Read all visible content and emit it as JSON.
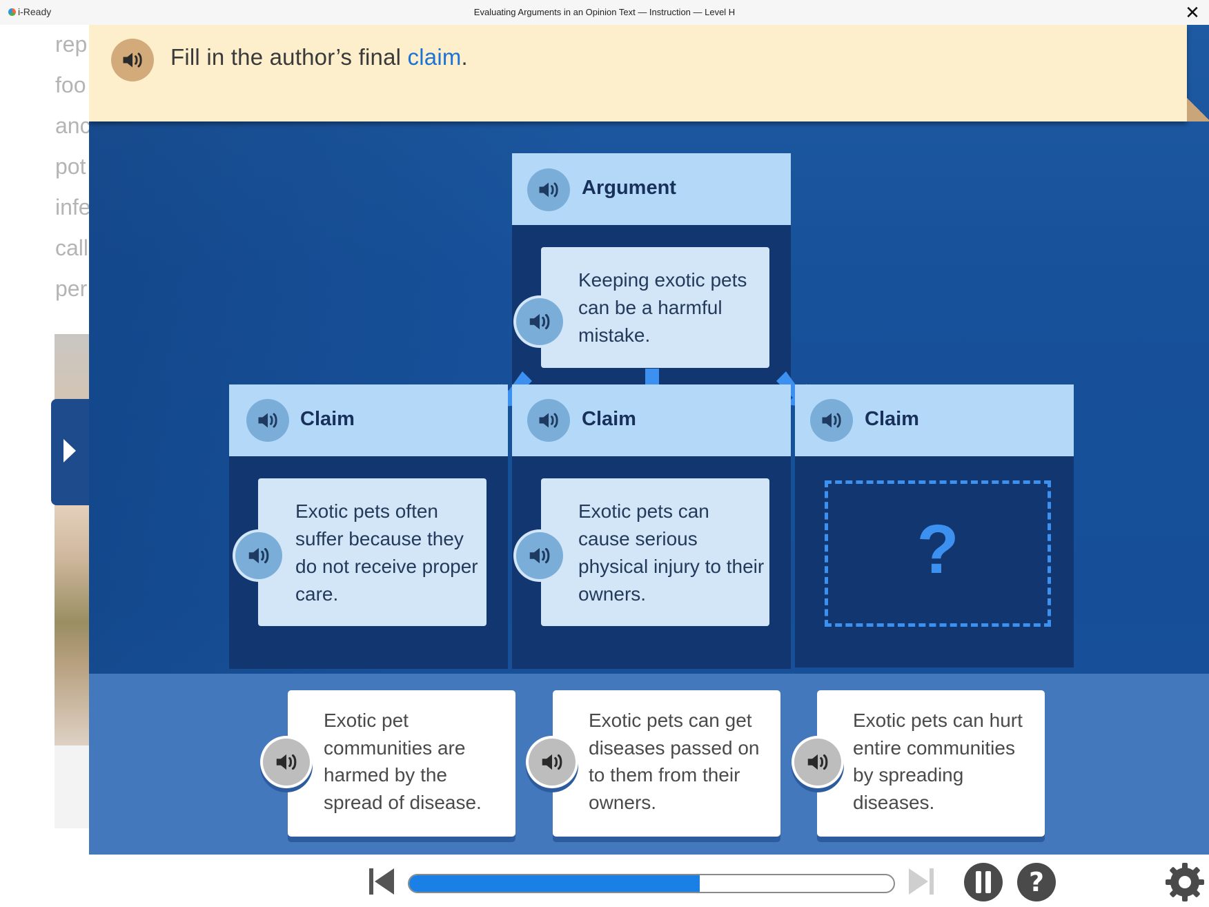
{
  "app": {
    "name": "i-Ready"
  },
  "window": {
    "title": "Evaluating Arguments in an Opinion Text — Instruction — Level H",
    "close_symbol": "✕"
  },
  "passage": {
    "lines": [
      "rep",
      "foo",
      "anc",
      "pot",
      "infe",
      "call",
      "per"
    ]
  },
  "banner": {
    "prompt_prefix": "Fill in the author’s final ",
    "prompt_keyword": "claim",
    "prompt_suffix": "."
  },
  "argument": {
    "heading": "Argument",
    "text": "Keeping exotic pets can be a harmful mistake."
  },
  "claims": [
    {
      "heading": "Claim",
      "text": "Exotic pets often suffer because they do not receive proper care."
    },
    {
      "heading": "Claim",
      "text": "Exotic pets can cause serious physical injury to their owners."
    },
    {
      "heading": "Claim",
      "placeholder": "?"
    }
  ],
  "answers": [
    {
      "text": "Exotic pet communities are harmed by the spread of disease."
    },
    {
      "text": "Exotic pets can get diseases passed on to them from their owners."
    },
    {
      "text": "Exotic pets can hurt entire communities by spreading diseases."
    }
  ],
  "progress": {
    "fraction": 0.6
  },
  "colors": {
    "banner": "#feefcc",
    "lesson_bg": "#17519a",
    "column_header": "#b3d8f8",
    "column_body": "#12366f",
    "card": "#d2e6f8",
    "accent_blue": "#3b90f0",
    "keyword_blue": "#1a74d6",
    "progress": "#1a80e6",
    "tray": "#4378bd"
  },
  "icons": {
    "speaker": "speaker-icon",
    "close": "close-icon",
    "sidebar_toggle": "play-triangle-icon",
    "back": "skip-back-icon",
    "forward": "skip-forward-icon",
    "pause": "pause-icon",
    "help": "help-icon",
    "settings": "gear-icon"
  }
}
